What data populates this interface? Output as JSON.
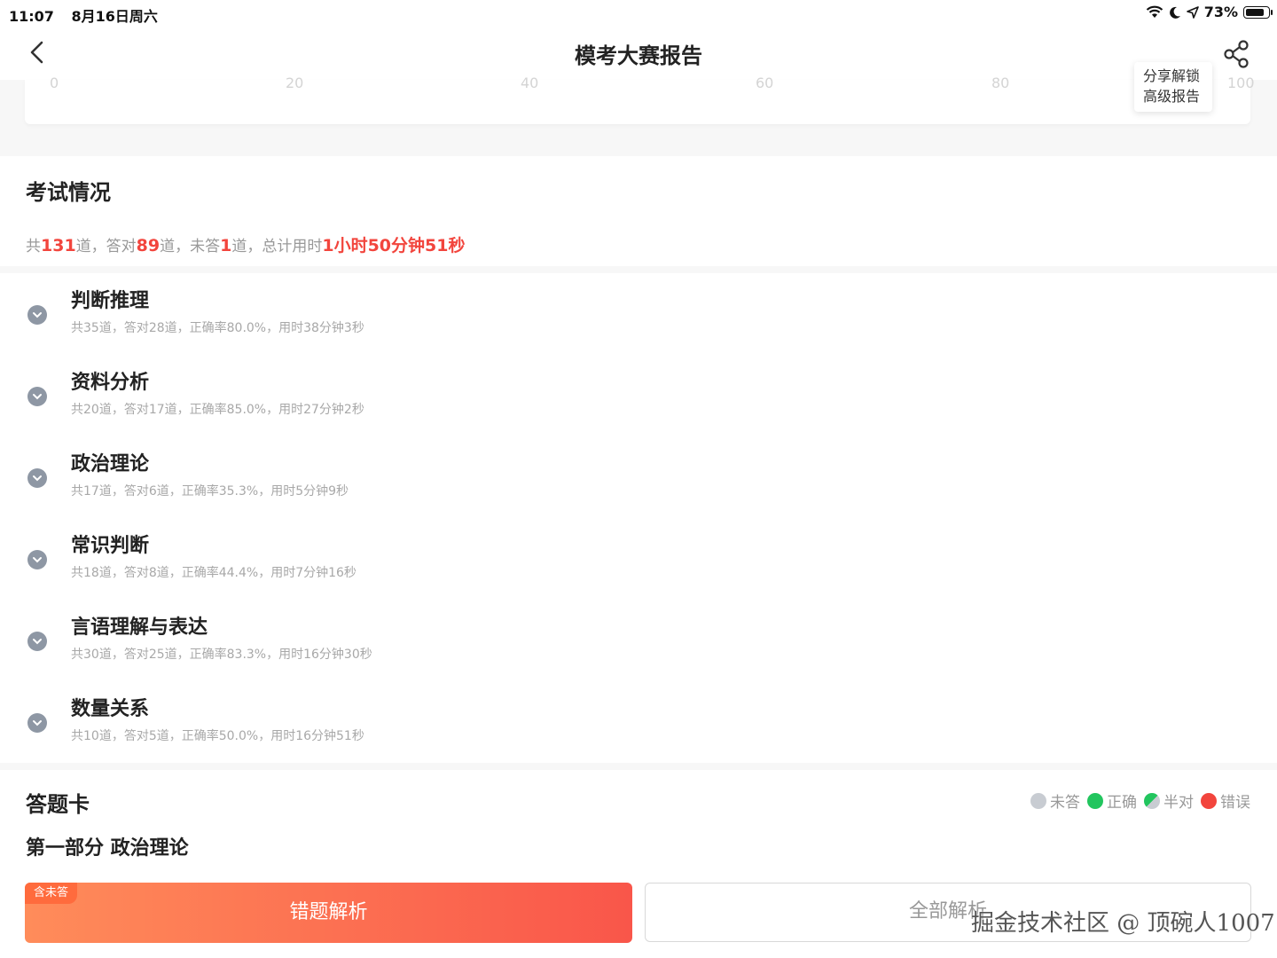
{
  "status_bar": {
    "time": "11:07",
    "date": "8月16日周六",
    "battery": "73%"
  },
  "nav": {
    "title": "模考大赛报告"
  },
  "score_axis": {
    "ticks": [
      "0",
      "20",
      "40",
      "60",
      "80",
      "100"
    ]
  },
  "tooltip": {
    "line1": "分享解锁",
    "line2": "高级报告"
  },
  "exam": {
    "title": "考试情况",
    "summary": {
      "prefix": "共",
      "total": "131",
      "t1": "道，答对",
      "correct": "89",
      "t2": "道，未答",
      "unanswered": "1",
      "t3": "道，总计用时",
      "time": "1小时50分钟51秒"
    }
  },
  "subjects": [
    {
      "name": "判断推理",
      "stats": "共35道，答对28道，正确率80.0%，用时38分钟3秒"
    },
    {
      "name": "资料分析",
      "stats": "共20道，答对17道，正确率85.0%，用时27分钟2秒"
    },
    {
      "name": "政治理论",
      "stats": "共17道，答对6道，正确率35.3%，用时5分钟9秒"
    },
    {
      "name": "常识判断",
      "stats": "共18道，答对8道，正确率44.4%，用时7分钟16秒"
    },
    {
      "name": "言语理解与表达",
      "stats": "共30道，答对25道，正确率83.3%，用时16分钟30秒"
    },
    {
      "name": "数量关系",
      "stats": "共10道，答对5道，正确率50.0%，用时16分钟51秒"
    }
  ],
  "answer_card": {
    "title": "答题卡",
    "legend": {
      "unanswered": "未答",
      "correct": "正确",
      "half": "半对",
      "wrong": "错误"
    },
    "part_title": "第一部分 政治理论"
  },
  "buttons": {
    "wrong_badge": "含未答",
    "wrong_label": "错题解析",
    "all_label": "全部解析"
  },
  "watermark": "掘金技术社区 @ 顶碗人1007",
  "colors": {
    "accent_red": "#f2453d",
    "correct_green": "#22c55e",
    "unanswered_gray": "#c8ccd2",
    "chevron_gray": "#8e97a4"
  }
}
